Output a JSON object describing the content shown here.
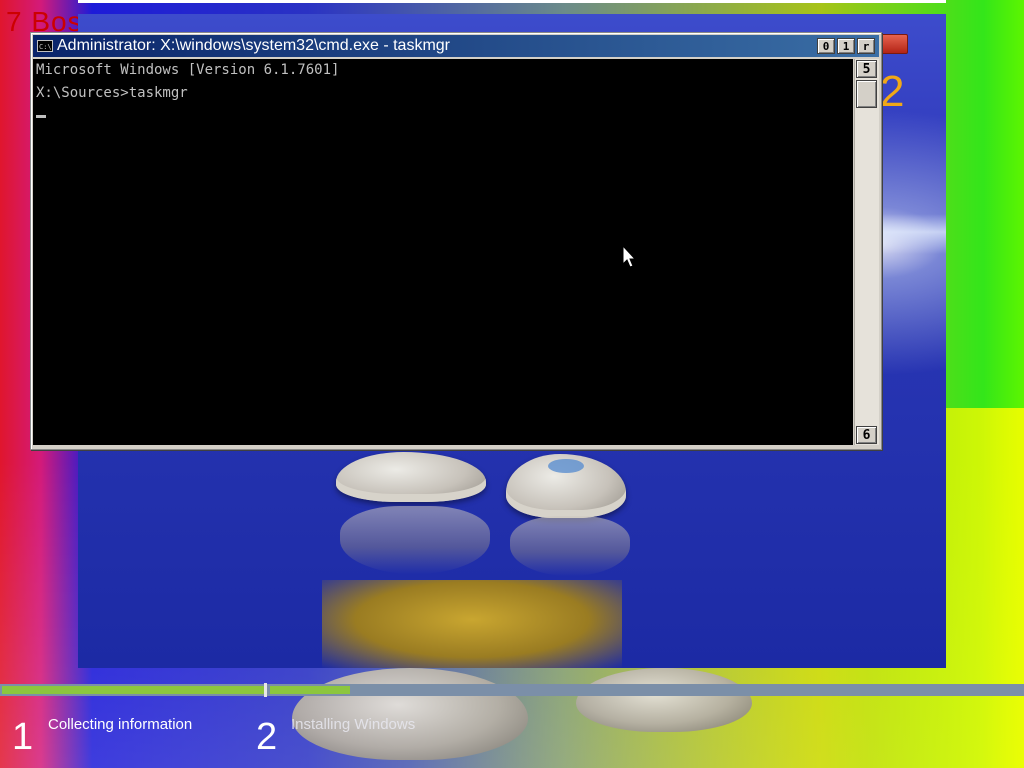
{
  "background": {
    "top_left_text": "7 Bos",
    "orange_digit": "2"
  },
  "cmd_window": {
    "title": "Administrator: X:\\windows\\system32\\cmd.exe - taskmgr",
    "icon_label": "C:\\",
    "buttons": {
      "minimize": "0",
      "maximize": "1",
      "close": "r"
    },
    "console_lines": [
      "Microsoft Windows [Version 6.1.7601]",
      "",
      "X:\\Sources>taskmgr"
    ],
    "scrollbar": {
      "up_arrow": "5",
      "down_arrow": "6"
    }
  },
  "setup_progress": {
    "steps": [
      {
        "number": "1",
        "label": "Collecting information"
      },
      {
        "number": "2",
        "label": "Installing Windows"
      }
    ]
  },
  "colors": {
    "progress_fill": "#8cc63e",
    "progress_track": "#7b8fa8",
    "titlebar_start": "#0a246a",
    "titlebar_end": "#3a6ea5",
    "console_bg": "#000000",
    "console_fg": "#c0c0c0"
  }
}
